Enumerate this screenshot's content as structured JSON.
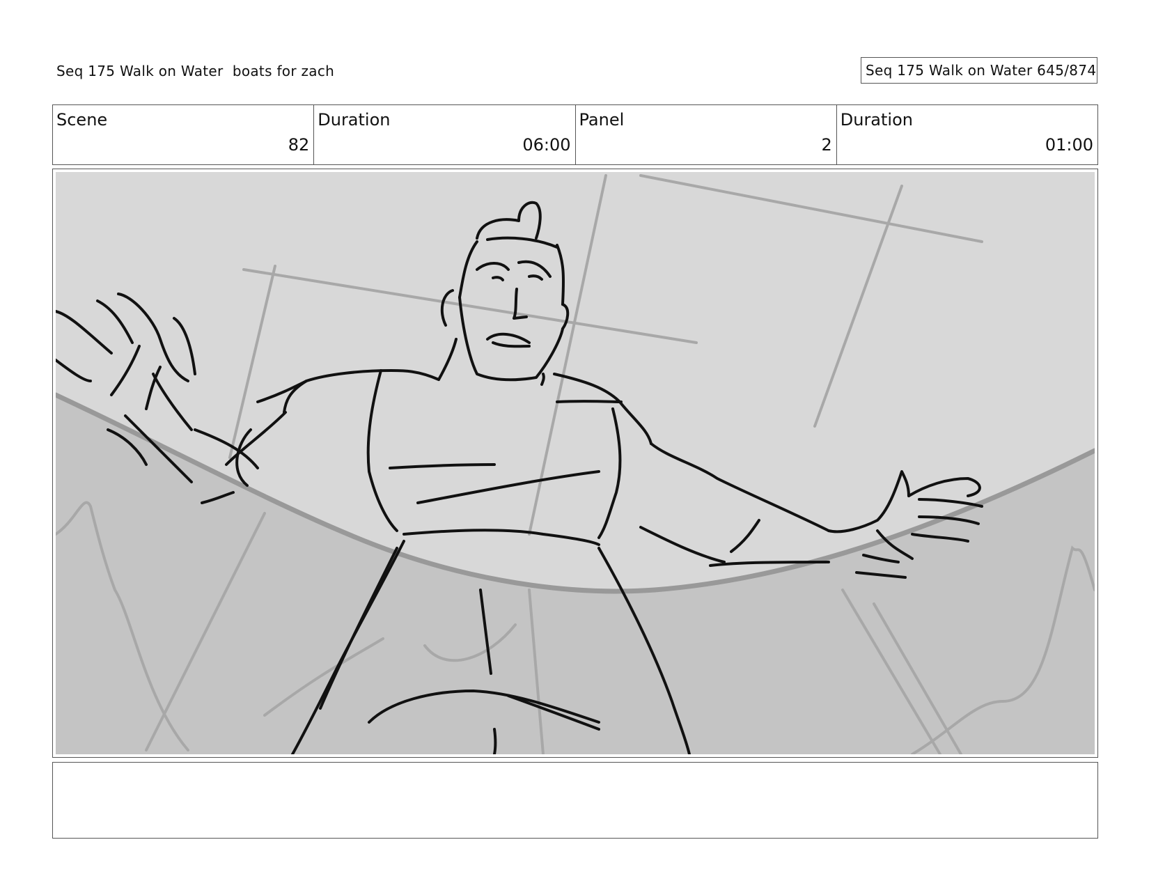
{
  "header": {
    "sequence_title": "Seq 175 Walk on Water  boats for zach",
    "page_counter": "Seq 175 Walk on Water 645/874"
  },
  "info": {
    "scene_label": "Scene",
    "scene_value": "82",
    "scene_duration_label": "Duration",
    "scene_duration_value": "06:00",
    "panel_label": "Panel",
    "panel_value": "2",
    "panel_duration_label": "Duration",
    "panel_duration_value": "01:00"
  },
  "frame": {
    "background_color": "#d8d8d8",
    "water_color": "#c4c4c4",
    "line_color": "#111111",
    "guide_color": "#a8a8a8"
  },
  "notes": {
    "text": ""
  }
}
